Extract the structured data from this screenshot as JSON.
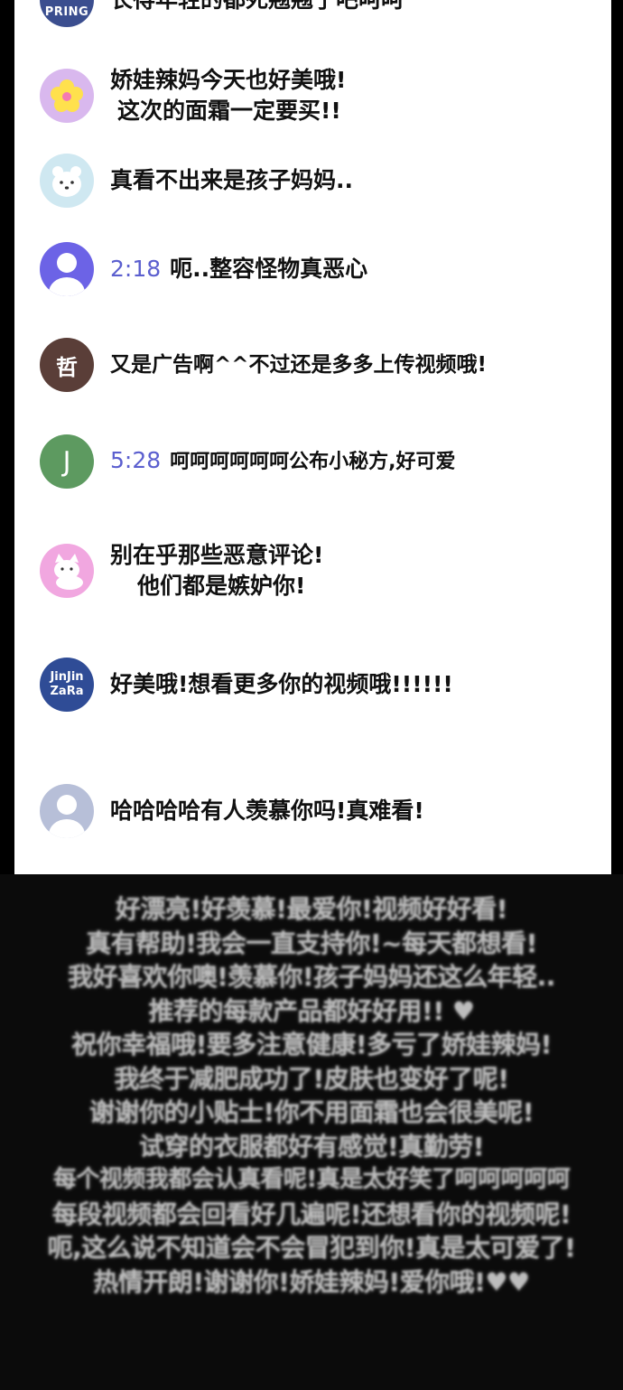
{
  "comments": [
    {
      "avatar_text": "PRING",
      "avatar_color": "#3b4e8f",
      "time": "",
      "text1": "长得年轻的都死翘翘了吧呵呵",
      "text2": ""
    },
    {
      "avatar_text": "",
      "avatar_color": "#d9b8ee",
      "avatar_icon": "flower-icon",
      "time": "",
      "text1": "娇娃辣妈今天也好美哦!",
      "text2": "这次的面霜一定要买!!"
    },
    {
      "avatar_text": "",
      "avatar_color": "#cfe8f1",
      "avatar_icon": "bear-icon",
      "time": "",
      "text1": "真看不出来是孩子妈妈..",
      "text2": ""
    },
    {
      "avatar_text": "",
      "avatar_color": "#6c63e6",
      "avatar_icon": "person-icon",
      "time": "2:18",
      "text1": "呃..整容怪物真恶心",
      "text2": ""
    },
    {
      "avatar_text": "哲",
      "avatar_color": "#5a3e38",
      "time": "",
      "text1": "又是广告啊^^不过还是多多上传视频哦!",
      "text2": ""
    },
    {
      "avatar_text": "J",
      "avatar_color": "#5d9a60",
      "time": "5:28",
      "text1": "呵呵呵呵呵呵公布小秘方,好可爱",
      "text2": ""
    },
    {
      "avatar_text": "",
      "avatar_color": "#f1a7e0",
      "avatar_icon": "cat-icon",
      "time": "",
      "text1": "别在乎那些恶意评论!",
      "text2": "他们都是嫉妒你!"
    },
    {
      "avatar_text": "JinJin ZaRa",
      "avatar_color": "#2f4c96",
      "time": "",
      "text1": "好美哦!想看更多你的视频哦!!!!!!",
      "text2": ""
    },
    {
      "avatar_text": "",
      "avatar_color": "#b7bfd8",
      "avatar_icon": "person-icon",
      "time": "",
      "text1": "哈哈哈哈有人羡慕你吗!真难看!",
      "text2": ""
    }
  ],
  "wall_lines": [
    "好漂亮!好羡慕!最爱你!视频好好看!",
    "真有帮助!我会一直支持你!~每天都想看!",
    "我好喜欢你噢!羡慕你!孩子妈妈还这么年轻..",
    "推荐的每款产品都好好用!! ♥",
    "祝你幸福哦!要多注意健康!多亏了娇娃辣妈!",
    "我终于减肥成功了!皮肤也变好了呢!",
    "谢谢你的小贴士!你不用面霜也会很美呢!",
    "试穿的衣服都好有感觉!真勤劳!",
    "每个视频我都会认真看呢!真是太好笑了呵呵呵呵呵",
    "每段视频都会回看好几遍呢!还想看你的视频呢!",
    "呃,这么说不知道会不会冒犯到你!真是太可爱了!",
    "热情开朗!谢谢你!娇娃辣妈!爱你哦!♥♥"
  ]
}
